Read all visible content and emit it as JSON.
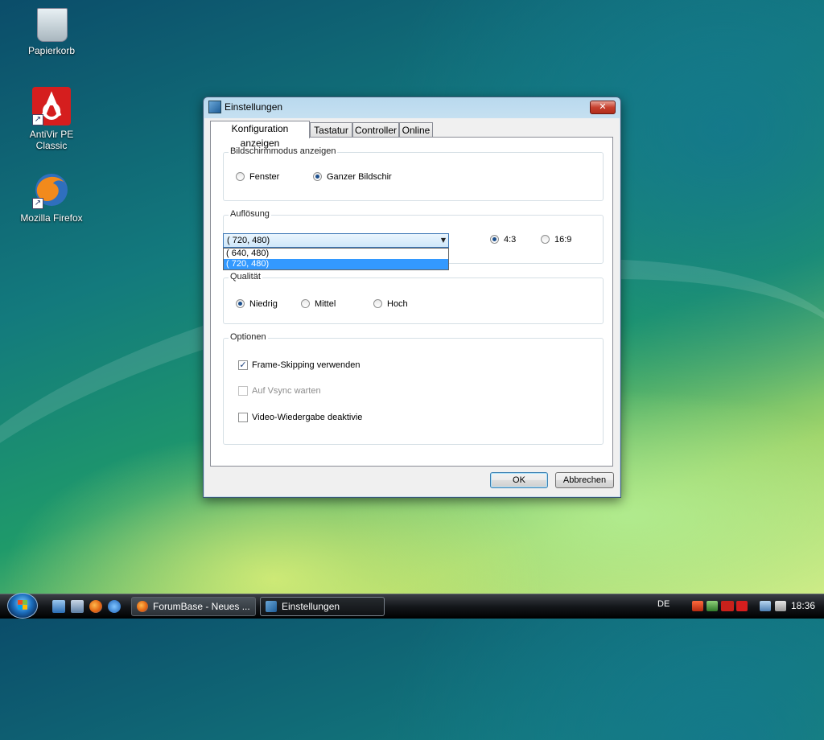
{
  "desktop": {
    "icons": [
      {
        "label": "Papierkorb"
      },
      {
        "label": "AntiVir PE Classic"
      },
      {
        "label": "Mozilla Firefox"
      }
    ]
  },
  "dialog": {
    "title": "Einstellungen",
    "close_label": "✕",
    "tabs": [
      {
        "label": "Konfiguration anzeigen",
        "active": true
      },
      {
        "label": "Tastatur",
        "active": false
      },
      {
        "label": "Controller",
        "active": false
      },
      {
        "label": "Online",
        "active": false
      }
    ],
    "display_mode": {
      "label": "Bildschirmmodus anzeigen",
      "options": [
        {
          "label": "Fenster",
          "checked": false
        },
        {
          "label": "Ganzer Bildschir",
          "checked": true
        }
      ]
    },
    "resolution": {
      "label": "Auflösung",
      "selected": "( 720, 480)",
      "list": [
        "( 640, 480)",
        "( 720, 480)"
      ],
      "list_selected_index": 1,
      "aspect": [
        {
          "label": "4:3",
          "checked": true
        },
        {
          "label": "16:9",
          "checked": false
        }
      ]
    },
    "quality": {
      "label": "Qualität",
      "options": [
        {
          "label": "Niedrig",
          "checked": true
        },
        {
          "label": "Mittel",
          "checked": false
        },
        {
          "label": "Hoch",
          "checked": false
        }
      ]
    },
    "options": {
      "label": "Optionen",
      "items": [
        {
          "label": "Frame-Skipping verwenden",
          "checked": true,
          "enabled": true
        },
        {
          "label": "Auf Vsync warten",
          "checked": false,
          "enabled": false
        },
        {
          "label": "Video-Wiedergabe deaktivie",
          "checked": false,
          "enabled": true
        }
      ]
    },
    "ok_label": "OK",
    "cancel_label": "Abbrechen"
  },
  "taskbar": {
    "tasks": [
      {
        "label": "ForumBase - Neues ...",
        "active": false
      },
      {
        "label": "Einstellungen",
        "active": true
      }
    ],
    "language": "DE",
    "clock": "18:36"
  },
  "colors": {
    "accent": "#3399ff",
    "dialog_frame": "#c4dceb",
    "close_button": "#c7412f"
  }
}
